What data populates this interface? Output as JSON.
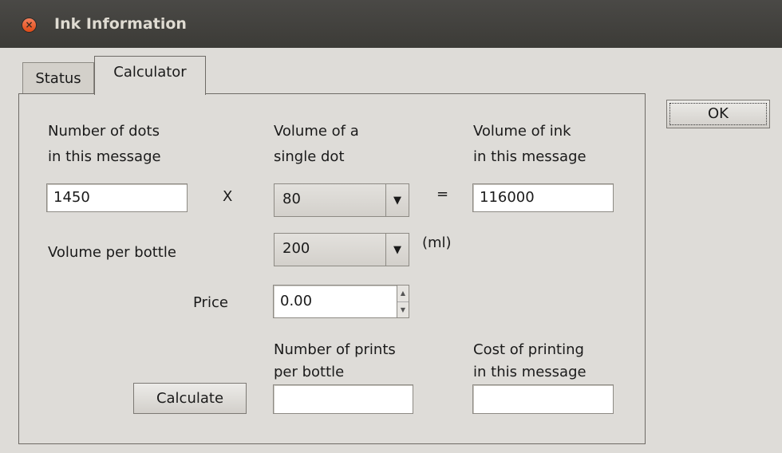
{
  "window": {
    "title": "Ink Information"
  },
  "tabs": [
    {
      "label": "Status"
    },
    {
      "label": "Calculator"
    }
  ],
  "buttons": {
    "ok": "OK",
    "calculate": "Calculate"
  },
  "calc": {
    "dots_label_1": "Number of dots",
    "dots_label_2": "in this message",
    "dots_value": "1450",
    "times_sign": "X",
    "dot_volume_label_1": "Volume of a",
    "dot_volume_label_2": "single dot",
    "dot_volume_value": "80",
    "equals_sign": "=",
    "ink_volume_label_1": "Volume of ink",
    "ink_volume_label_2": "in this message",
    "ink_volume_value": "116000",
    "bottle_label": "Volume per bottle",
    "bottle_value": "200",
    "bottle_unit": "(ml)",
    "price_label": "Price",
    "price_value": "0.00",
    "prints_label_1": "Number of prints",
    "prints_label_2": "per bottle",
    "prints_value": "",
    "cost_label_1": "Cost of printing",
    "cost_label_2": "in this message",
    "cost_value": ""
  }
}
